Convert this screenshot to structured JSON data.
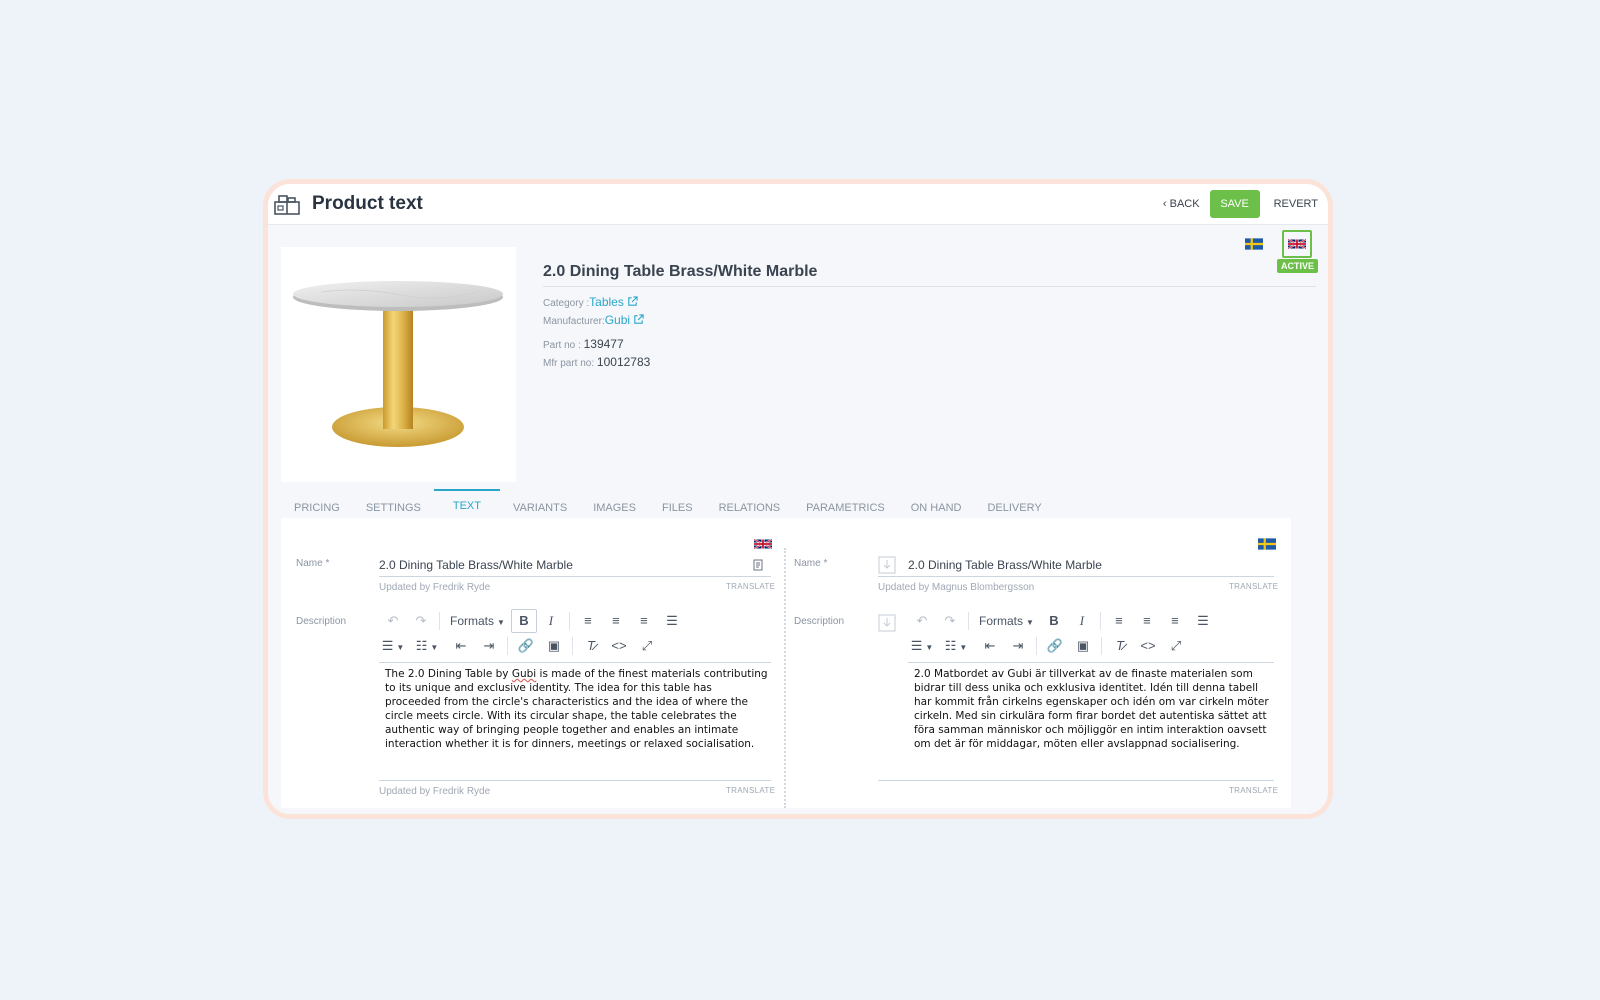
{
  "header": {
    "title": "Product text",
    "back_label": "BACK",
    "save_label": "SAVE",
    "revert_label": "REVERT"
  },
  "languages": {
    "active_label": "ACTIVE"
  },
  "product": {
    "name": "2.0 Dining Table Brass/White Marble",
    "category_label": "Category :",
    "category_value": "Tables",
    "manufacturer_label": "Manufacturer:",
    "manufacturer_value": "Gubi",
    "part_no_label": "Part no :",
    "part_no_value": "139477",
    "mfr_part_no_label": "Mfr part no:",
    "mfr_part_no_value": "10012783"
  },
  "tabs": [
    "PRICING",
    "SETTINGS",
    "TEXT",
    "VARIANTS",
    "IMAGES",
    "FILES",
    "RELATIONS",
    "PARAMETRICS",
    "ON HAND",
    "DELIVERY"
  ],
  "active_tab": "TEXT",
  "editor_en": {
    "name_label": "Name *",
    "name_value": "2.0 Dining Table Brass/White Marble",
    "name_updated": "Updated by Fredrik Ryde",
    "translate_label": "TRANSLATE",
    "description_label": "Description",
    "formats_label": "Formats",
    "description_before": "The 2.0 Dining Table by ",
    "description_brand": "Gubi",
    "description_after": " is made of the finest materials contributing to its unique and exclusive identity. The idea for this table has proceeded from the circle's characteristics and the idea of where the circle meets circle. With its circular shape, the table celebrates the authentic way of bringing people together and enables an intimate interaction whether it is for dinners, meetings or relaxed socialisation.",
    "description_updated": "Updated by Fredrik Ryde"
  },
  "editor_sv": {
    "name_label": "Name *",
    "name_value": "2.0 Dining Table Brass/White Marble",
    "name_updated": "Updated by Magnus Blombergsson",
    "translate_label": "TRANSLATE",
    "description_label": "Description",
    "formats_label": "Formats",
    "description": "2.0 Matbordet av Gubi är tillverkat av de finaste materialen som bidrar till dess unika och exklusiva identitet. Idén till denna tabell har kommit från cirkelns egenskaper och idén om var cirkeln möter cirkeln. Med sin cirkulära form firar bordet det autentiska sättet att föra samman människor och möjliggör en intim interaktion oavsett om det är för middagar, möten eller avslappnad socialisering."
  },
  "colors": {
    "accent": "#2aa6c9",
    "save": "#6cc04a",
    "background": "#eef2f9"
  }
}
